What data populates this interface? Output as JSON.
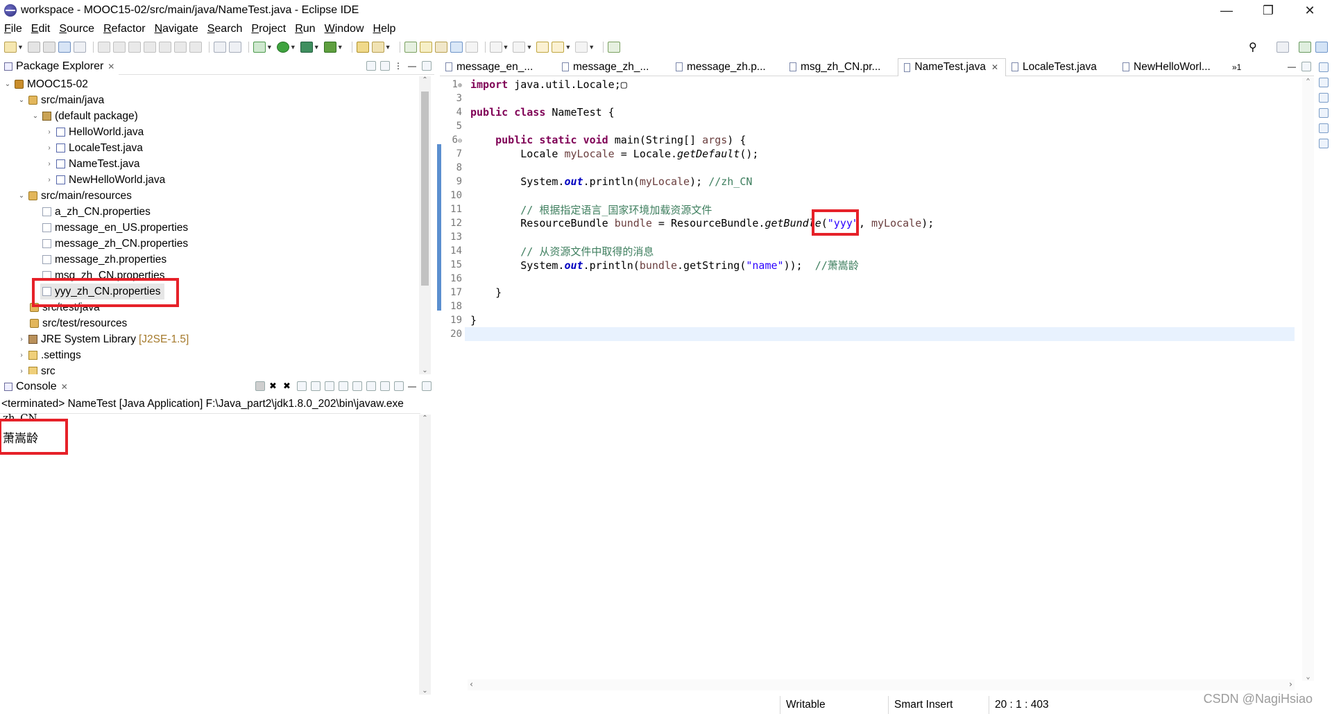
{
  "window": {
    "title": "workspace - MOOC15-02/src/main/java/NameTest.java - Eclipse IDE",
    "controls": [
      "minimize",
      "restore",
      "close"
    ]
  },
  "menu": [
    "File",
    "Edit",
    "Source",
    "Refactor",
    "Navigate",
    "Search",
    "Project",
    "Run",
    "Window",
    "Help"
  ],
  "explorer": {
    "tab_label": "Package Explorer",
    "tree": [
      {
        "label": "MOOC15-02",
        "icon": "project-icon",
        "twisty": "open"
      },
      {
        "label": "src/main/java",
        "icon": "source-folder-icon",
        "twisty": "open"
      },
      {
        "label": "(default package)",
        "icon": "package-icon",
        "twisty": "open"
      },
      {
        "label": "HelloWorld.java",
        "icon": "java-file-icon",
        "twisty": "closed"
      },
      {
        "label": "LocaleTest.java",
        "icon": "java-file-icon",
        "twisty": "closed"
      },
      {
        "label": "NameTest.java",
        "icon": "java-file-icon",
        "twisty": "closed"
      },
      {
        "label": "NewHelloWorld.java",
        "icon": "java-file-icon",
        "twisty": "closed"
      },
      {
        "label": "src/main/resources",
        "icon": "source-folder-icon",
        "twisty": "open"
      },
      {
        "label": "a_zh_CN.properties",
        "icon": "properties-file-icon"
      },
      {
        "label": "message_en_US.properties",
        "icon": "properties-file-icon"
      },
      {
        "label": "message_zh_CN.properties",
        "icon": "properties-file-icon"
      },
      {
        "label": "message_zh.properties",
        "icon": "properties-file-icon"
      },
      {
        "label": "msg_zh_CN.properties",
        "icon": "properties-file-icon"
      },
      {
        "label": "yyy_zh_CN.properties",
        "icon": "properties-file-icon",
        "selected": true
      },
      {
        "label": "src/test/java",
        "icon": "source-folder-icon"
      },
      {
        "label": "src/test/resources",
        "icon": "source-folder-icon"
      },
      {
        "label": "JRE System Library",
        "version": "[J2SE-1.5]",
        "icon": "library-icon",
        "twisty": "closed"
      },
      {
        "label": ".settings",
        "icon": "folder-icon",
        "twisty": "closed"
      },
      {
        "label": "src",
        "icon": "folder-icon",
        "twisty": "closed"
      }
    ]
  },
  "editor": {
    "tabs": [
      {
        "label": "message_en_..."
      },
      {
        "label": "message_zh_..."
      },
      {
        "label": "message_zh.p..."
      },
      {
        "label": "msg_zh_CN.pr..."
      },
      {
        "label": "NameTest.java",
        "active": true
      },
      {
        "label": "LocaleTest.java"
      },
      {
        "label": "NewHelloWorl..."
      }
    ],
    "overflow_count": "»1",
    "lines": [
      {
        "n": "1",
        "fold": "⊕",
        "text": "import java.util.Locale;"
      },
      {
        "n": "3",
        "text": ""
      },
      {
        "n": "4",
        "text": "public class NameTest {"
      },
      {
        "n": "5",
        "text": ""
      },
      {
        "n": "6",
        "fold": "⊖",
        "text": "    public static void main(String[] args) {"
      },
      {
        "n": "7",
        "text": "        Locale myLocale = Locale.getDefault();"
      },
      {
        "n": "8",
        "text": ""
      },
      {
        "n": "9",
        "text": "        System.out.println(myLocale); //zh_CN"
      },
      {
        "n": "10",
        "text": ""
      },
      {
        "n": "11",
        "text": "        // 根据指定语言_国家环境加载资源文件"
      },
      {
        "n": "12",
        "text": "        ResourceBundle bundle = ResourceBundle.getBundle(\"yyy\", myLocale);"
      },
      {
        "n": "13",
        "text": ""
      },
      {
        "n": "14",
        "text": "        // 从资源文件中取得的消息"
      },
      {
        "n": "15",
        "text": "        System.out.println(bundle.getString(\"name\"));  //萧嵩龄"
      },
      {
        "n": "16",
        "text": ""
      },
      {
        "n": "17",
        "text": "    }"
      },
      {
        "n": "18",
        "text": ""
      },
      {
        "n": "19",
        "text": "}"
      },
      {
        "n": "20",
        "text": ""
      }
    ]
  },
  "console": {
    "tab_label": "Console",
    "header": "<terminated> NameTest [Java Application] F:\\Java_part2\\jdk1.8.0_202\\bin\\javaw.exe",
    "output": [
      "zh_CN",
      "萧嵩龄"
    ]
  },
  "status": {
    "writable": "Writable",
    "insert_mode": "Smart Insert",
    "position": "20 : 1 : 403"
  },
  "watermark": "CSDN @NagiHsiao",
  "colors": {
    "highlight_box": "#e62129",
    "keyword": "#7f0055",
    "string": "#2a00ff",
    "comment": "#3f7f5f",
    "field": "#0000c0",
    "current_line": "#e8f2fe"
  }
}
